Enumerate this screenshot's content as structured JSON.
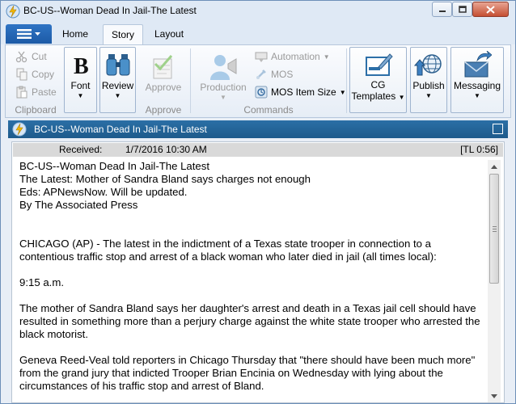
{
  "window": {
    "title": "BC-US--Woman Dead In Jail-The Latest"
  },
  "ribbon": {
    "tabs": [
      "Home",
      "Story",
      "Layout"
    ],
    "active_tab": "Story",
    "clipboard": {
      "cut": "Cut",
      "copy": "Copy",
      "paste": "Paste",
      "group_label": "Clipboard"
    },
    "font_label": "Font",
    "review_label": "Review",
    "approve": {
      "button_label": "Approve",
      "group_label": "Approve"
    },
    "commands": {
      "production_label": "Production",
      "automation_label": "Automation",
      "mos_label": "MOS",
      "mos_item_size_label": "MOS Item Size",
      "group_label": "Commands"
    },
    "cg_templates_line1": "CG",
    "cg_templates_line2": "Templates",
    "publish_label": "Publish",
    "messaging_label": "Messaging"
  },
  "document": {
    "header_title": "BC-US--Woman Dead In Jail-The Latest",
    "received_label": "Received:",
    "received_value": "1/7/2016 10:30 AM",
    "tl_value": "[TL 0:56]",
    "lines": {
      "slug": "BC-US--Woman Dead In Jail-The Latest",
      "headline": "The Latest: Mother of Sandra Bland says charges not enough",
      "eds": "Eds: APNewsNow. Will be updated.",
      "byline": "By The Associated Press",
      "para1": "CHICAGO (AP) - The latest in the indictment of a Texas state trooper in connection to a contentious traffic stop and arrest of a black woman who later died in jail (all times local):",
      "time": "9:15 a.m.",
      "para2": "The mother of Sandra Bland says her daughter's arrest and death in a Texas jail cell should have resulted in something more than a perjury charge against the white state trooper who arrested the black motorist.",
      "para3": "Geneva Reed-Veal told reporters in Chicago Thursday that \"there should have been much more\" from the grand jury that indicted Trooper Brian Encinia on Wednesday with lying about the circumstances of his traffic stop and arrest of Bland."
    }
  },
  "colors": {
    "doc_header_bg": "#1d5a8b",
    "app_menu_bg": "#1c5aa6",
    "received_bar_bg": "#d9d9d9"
  },
  "icons": {
    "app": "lightning-app-icon",
    "minimize": "minimize-icon",
    "maximize": "maximize-icon",
    "close": "close-icon",
    "menu": "hamburger-menu-icon",
    "popout": "popout-icon"
  }
}
